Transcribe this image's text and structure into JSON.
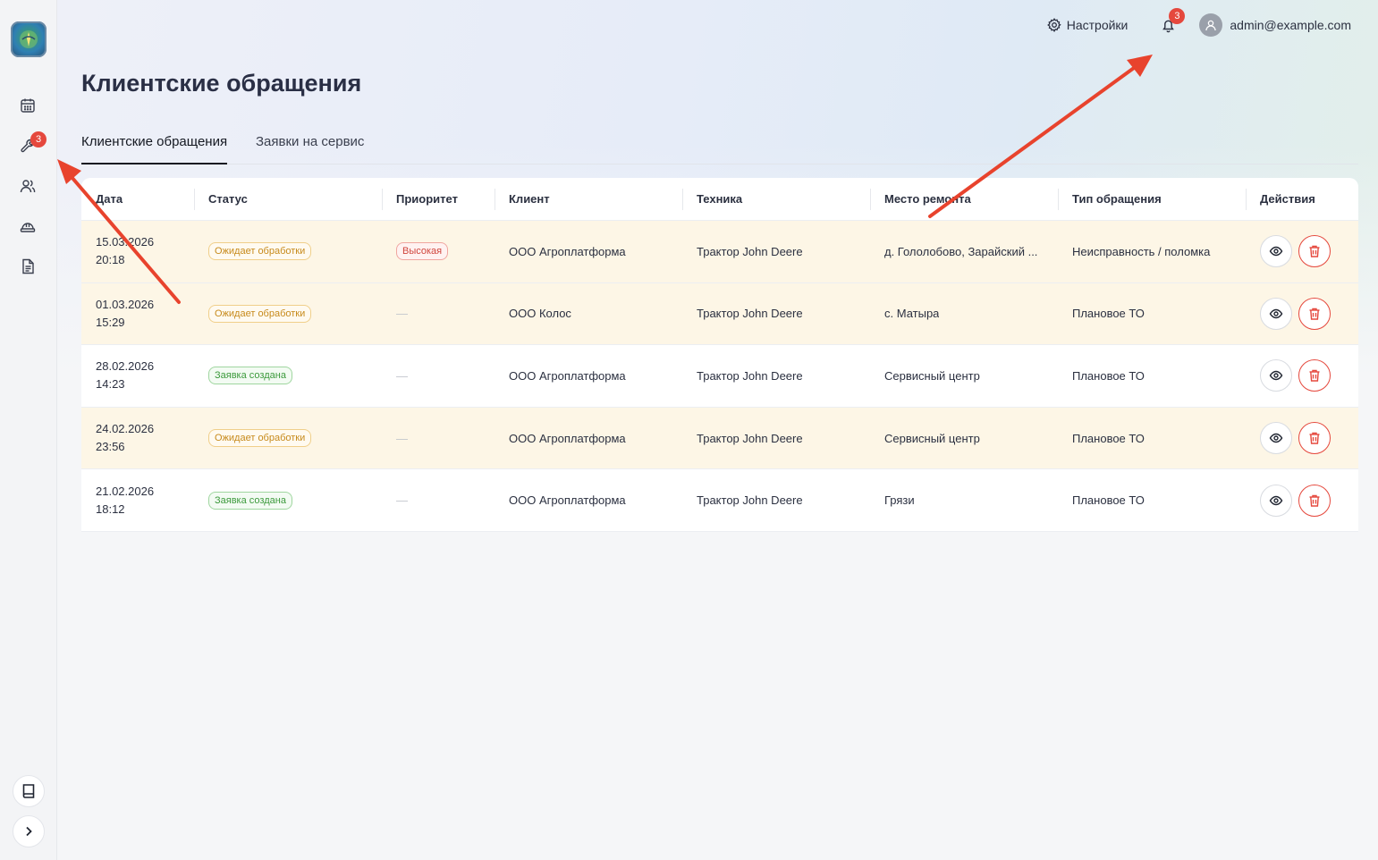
{
  "header": {
    "settings_label": "Настройки",
    "notifications_count": "3",
    "user_email": "admin@example.com"
  },
  "sidebar": {
    "badge_count": "3",
    "items": [
      {
        "icon": "calendar-icon"
      },
      {
        "icon": "wrench-icon"
      },
      {
        "icon": "users-icon"
      },
      {
        "icon": "helmet-icon"
      },
      {
        "icon": "document-icon"
      }
    ],
    "bottom": [
      {
        "icon": "book-icon"
      },
      {
        "icon": "chevron-right-icon"
      }
    ]
  },
  "page": {
    "title": "Клиентские обращения",
    "tabs": [
      "Клиентские обращения",
      "Заявки на сервис"
    ]
  },
  "table": {
    "columns": [
      "Дата",
      "Статус",
      "Приоритет",
      "Клиент",
      "Техника",
      "Место ремонта",
      "Тип обращения",
      "Действия"
    ],
    "rows": [
      {
        "date": "15.03.2026\n20:18",
        "status": "Ожидает обработки",
        "status_kind": "pending",
        "priority": "Высокая",
        "client": "ООО Агроплатформа",
        "machine": "Трактор John Deere",
        "place": "д. Гололобово, Зарайский ...",
        "type": "Неисправность / поломка"
      },
      {
        "date": "01.03.2026\n15:29",
        "status": "Ожидает обработки",
        "status_kind": "pending",
        "priority": "—",
        "client": "ООО Колос",
        "machine": "Трактор John Deere",
        "place": "с. Матыра",
        "type": "Плановое ТО"
      },
      {
        "date": "28.02.2026\n14:23",
        "status": "Заявка создана",
        "status_kind": "created",
        "priority": "—",
        "client": "ООО Агроплатформа",
        "machine": "Трактор John Deere",
        "place": "Сервисный центр",
        "type": "Плановое ТО"
      },
      {
        "date": "24.02.2026\n23:56",
        "status": "Ожидает обработки",
        "status_kind": "pending",
        "priority": "—",
        "client": "ООО Агроплатформа",
        "machine": "Трактор John Deere",
        "place": "Сервисный центр",
        "type": "Плановое ТО"
      },
      {
        "date": "21.02.2026\n18:12",
        "status": "Заявка создана",
        "status_kind": "created",
        "priority": "—",
        "client": "ООО Агроплатформа",
        "machine": "Трактор John Deere",
        "place": "Грязи",
        "type": "Плановое ТО"
      }
    ]
  },
  "colors": {
    "accent_red": "#e5483d",
    "pending_row": "#fdf6e6",
    "pending_badge": "#c78a1b",
    "created_badge": "#3c9a3c",
    "annotation_arrow": "#e8432d"
  }
}
